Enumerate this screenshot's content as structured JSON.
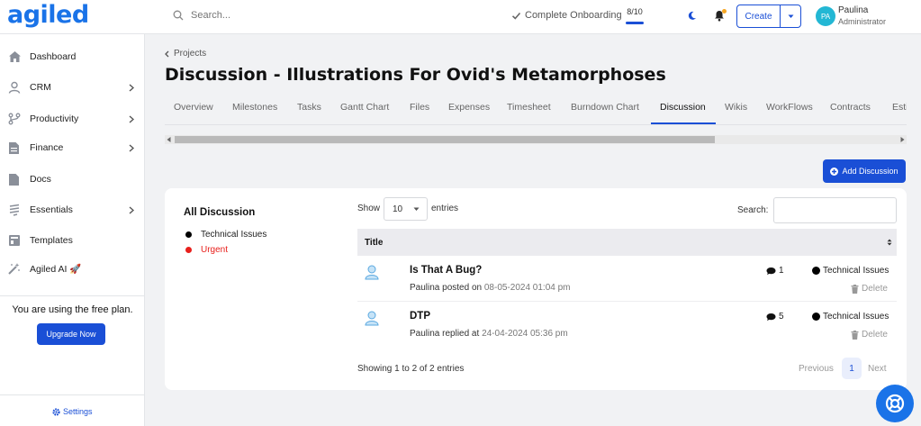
{
  "brand": {
    "logo_text": "agiled",
    "accent": "#1a4fd6"
  },
  "header": {
    "search_placeholder": "Search...",
    "onboarding_label": "Complete Onboarding",
    "onboarding_count": "8/10",
    "create_label": "Create",
    "user": {
      "initials": "PA",
      "name": "Paulina",
      "role": "Administrator"
    }
  },
  "sidebar": {
    "items": [
      {
        "label": "Dashboard",
        "icon": "home-icon"
      },
      {
        "label": "CRM",
        "icon": "user-icon",
        "has_submenu": true
      },
      {
        "label": "Productivity",
        "icon": "branch-icon",
        "has_submenu": true
      },
      {
        "label": "Finance",
        "icon": "document-icon",
        "has_submenu": true
      },
      {
        "label": "Docs",
        "icon": "file-icon"
      },
      {
        "label": "Essentials",
        "icon": "layers-icon",
        "has_submenu": true
      },
      {
        "label": "Templates",
        "icon": "template-icon"
      },
      {
        "label": "Agiled AI 🚀",
        "icon": "magic-wand-icon"
      }
    ],
    "free_plan_text": "You are using the free plan.",
    "upgrade_label": "Upgrade Now",
    "settings_label": "Settings"
  },
  "main": {
    "breadcrumb": "Projects",
    "title": "Discussion - Illustrations For Ovid's Metamorphoses",
    "tabs": [
      "Overview",
      "Milestones",
      "Tasks",
      "Gantt Chart",
      "Files",
      "Expenses",
      "Timesheet",
      "Burndown Chart",
      "Discussion",
      "Wikis",
      "WorkFlows",
      "Contracts",
      "Esti"
    ],
    "active_tab": "Discussion",
    "add_button_label": "Add Discussion"
  },
  "categories": {
    "title": "All Discussion",
    "items": [
      {
        "label": "Technical Issues",
        "color": "#000000"
      },
      {
        "label": "Urgent",
        "color": "#e8201c"
      }
    ]
  },
  "table": {
    "show_label": "Show",
    "entries_value": "10",
    "entries_label": "entries",
    "search_label": "Search:",
    "column_title": "Title",
    "rows": [
      {
        "title": "Is That A Bug?",
        "meta_prefix": "Paulina posted on",
        "date": "08-05-2024 01:04 pm",
        "comments": "1",
        "category": "Technical Issues",
        "delete_label": "Delete"
      },
      {
        "title": "DTP",
        "meta_prefix": "Paulina replied at",
        "date": "24-04-2024 05:36 pm",
        "comments": "5",
        "category": "Technical Issues",
        "delete_label": "Delete"
      }
    ],
    "info": "Showing 1 to 2 of 2 entries",
    "pagination": {
      "previous": "Previous",
      "current": "1",
      "next": "Next"
    }
  }
}
